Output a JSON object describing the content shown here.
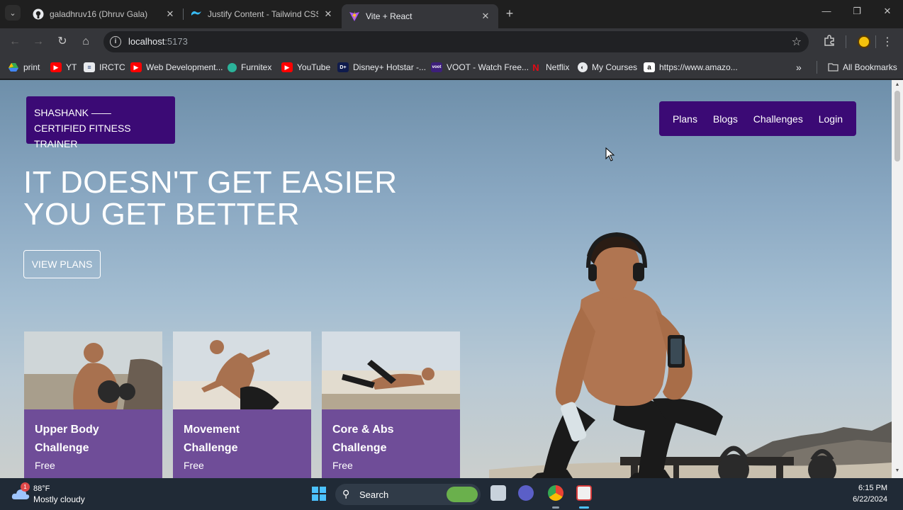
{
  "browser": {
    "tabs": [
      {
        "title": "galadhruv16 (Dhruv Gala)",
        "icon": "github-icon"
      },
      {
        "title": "Justify Content - Tailwind CSS",
        "icon": "tailwind-icon"
      },
      {
        "title": "Vite + React",
        "icon": "vite-icon",
        "active": true
      }
    ],
    "url_host": "localhost",
    "url_port": ":5173",
    "bookmarks": [
      {
        "label": "print",
        "icon": "drive-icon"
      },
      {
        "label": "YT",
        "icon": "youtube-icon"
      },
      {
        "label": "IRCTC",
        "icon": "irctc-icon"
      },
      {
        "label": "Web Development...",
        "icon": "youtube-icon"
      },
      {
        "label": "Furnitex",
        "icon": "furnitex-icon"
      },
      {
        "label": "YouTube",
        "icon": "youtube-icon"
      },
      {
        "label": "Disney+ Hotstar -...",
        "icon": "hotstar-icon"
      },
      {
        "label": "VOOT - Watch Free...",
        "icon": "voot-icon"
      },
      {
        "label": "Netflix",
        "icon": "netflix-icon"
      },
      {
        "label": "My Courses",
        "icon": "globe-icon"
      },
      {
        "label": "https://www.amazo...",
        "icon": "amazon-icon"
      }
    ],
    "all_bookmarks": "All Bookmarks"
  },
  "page": {
    "brand_line1": "SHASHANK ——",
    "brand_line2": "CERTIFIED FITNESS TRAINER",
    "nav": [
      "Plans",
      "Blogs",
      "Challenges",
      "Login"
    ],
    "hero_line1": "IT DOESN'T GET EASIER",
    "hero_line2": "YOU GET BETTER",
    "cta": "VIEW PLANS",
    "cards": [
      {
        "title_line1": "Upper Body",
        "title_line2": "Challenge",
        "price": "Free"
      },
      {
        "title_line1": "Movement",
        "title_line2": "Challenge",
        "price": "Free"
      },
      {
        "title_line1": "Core & Abs",
        "title_line2": "Challenge",
        "price": "Free"
      }
    ],
    "colors": {
      "brand": "#3b0a75",
      "card": "#6f4d98"
    }
  },
  "taskbar": {
    "weather_temp": "88°F",
    "weather_desc": "Mostly cloudy",
    "weather_badge": "1",
    "search_label": "Search",
    "time": "6:15 PM",
    "date": "6/22/2024"
  }
}
